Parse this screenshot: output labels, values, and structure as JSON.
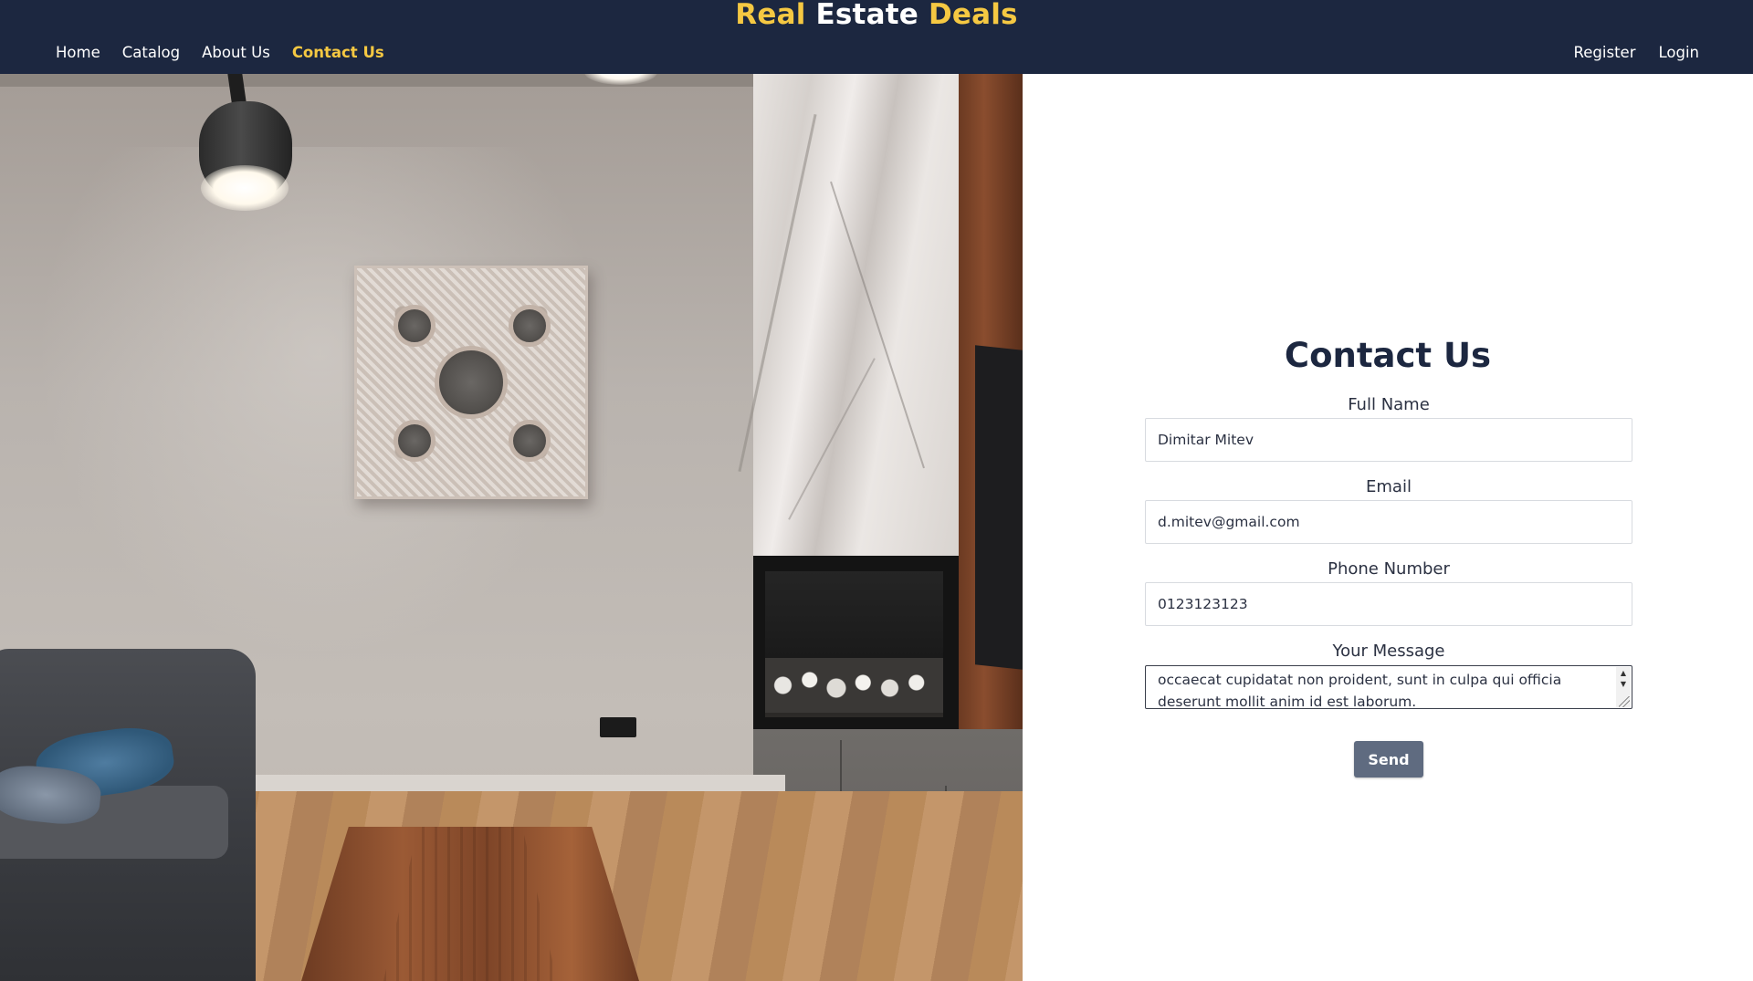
{
  "brand": {
    "word1": "Real",
    "word2": "Estate",
    "word3": "Deals"
  },
  "nav": {
    "left": [
      {
        "label": "Home"
      },
      {
        "label": "Catalog"
      },
      {
        "label": "About Us"
      },
      {
        "label": "Contact Us",
        "active": true
      }
    ],
    "right": [
      {
        "label": "Register"
      },
      {
        "label": "Login"
      }
    ]
  },
  "contact": {
    "title": "Contact Us",
    "full_name": {
      "label": "Full Name",
      "value": "Dimitar Mitev"
    },
    "email": {
      "label": "Email",
      "value": "d.mitev@gmail.com"
    },
    "phone": {
      "label": "Phone Number",
      "value": "0123123123"
    },
    "message": {
      "label": "Your Message",
      "value": "occaecat cupidatat non proident, sunt in culpa qui officia deserunt mollit anim id est laborum."
    },
    "send_label": "Send"
  },
  "colors": {
    "header_bg": "#1c2740",
    "accent": "#f5c842",
    "button_bg": "#5f6b80"
  }
}
